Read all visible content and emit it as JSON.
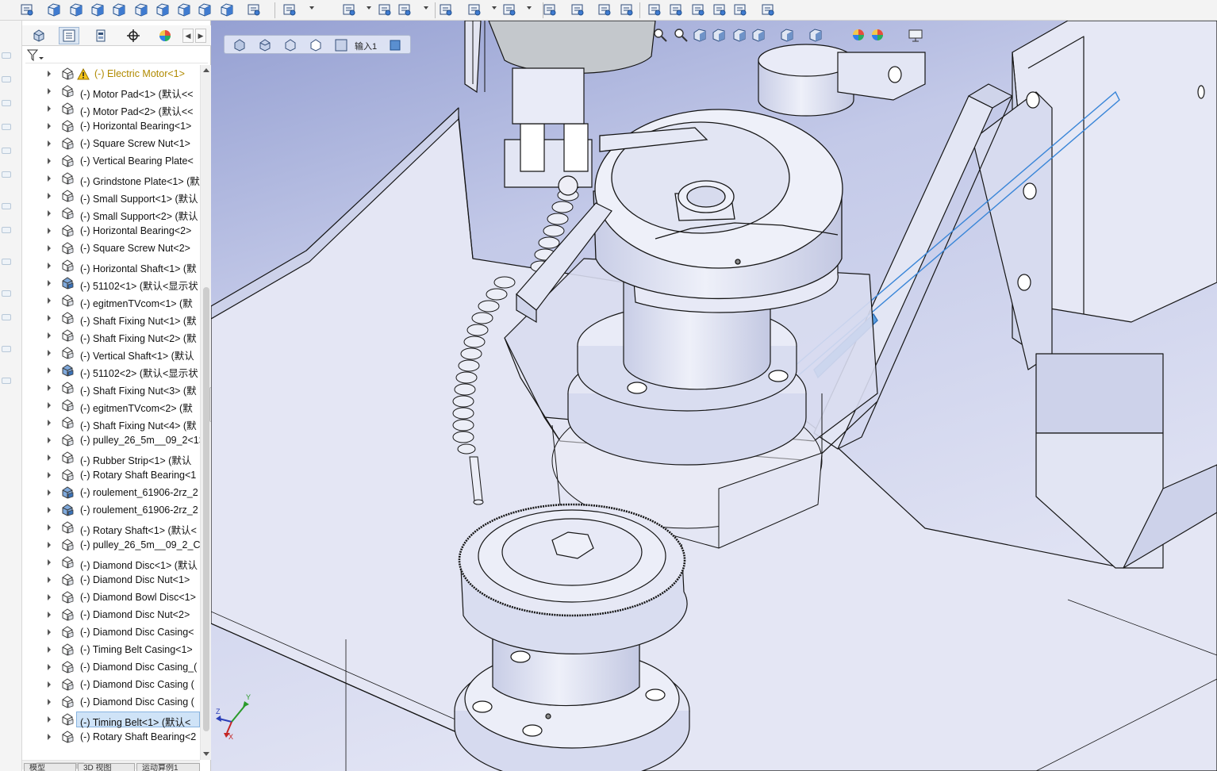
{
  "toolbar": {
    "icons": [
      "move-up-icon",
      "view-front-icon",
      "view-back-icon",
      "view-left-icon",
      "view-right-icon",
      "view-top-icon",
      "view-bottom-icon",
      "view-iso-icon",
      "view-dimetric-icon",
      "view-trimetric-icon",
      "magic-brush-icon",
      "smart-mates-icon",
      "assembly-features-icon",
      "linear-pattern-icon",
      "edit-component-icon",
      "insert-part-icon",
      "exploded-view-icon",
      "reference-geometry-icon",
      "move-component-icon",
      "interference-icon",
      "mate-icon",
      "hide-show-icon",
      "instant3d-icon",
      "bill-of-materials-icon",
      "assembly-visualization-icon",
      "large-assembly-icon",
      "speedpak-icon",
      "appearance-icon",
      "measure-icon"
    ]
  },
  "feature_manager": {
    "tabs": [
      "feature-tree-tab",
      "property-manager-tab",
      "configuration-manager-tab",
      "dimxpert-tab",
      "display-manager-tab"
    ],
    "filter_icon": "filter-icon",
    "items": [
      {
        "label": "(-) Electric Motor<1>",
        "icon": "part-icon",
        "warning": true
      },
      {
        "label": "(-) Motor Pad<1> (默认<<",
        "icon": "part-icon"
      },
      {
        "label": "(-) Motor Pad<2> (默认<<",
        "icon": "part-icon"
      },
      {
        "label": "(-) Horizontal Bearing<1>",
        "icon": "part-icon"
      },
      {
        "label": "(-) Square Screw Nut<1>",
        "icon": "part-icon"
      },
      {
        "label": "(-) Vertical Bearing Plate<",
        "icon": "part-icon"
      },
      {
        "label": "(-) Grindstone Plate<1> (默",
        "icon": "part-icon"
      },
      {
        "label": "(-) Small Support<1> (默认",
        "icon": "part-icon"
      },
      {
        "label": "(-) Small Support<2> (默认",
        "icon": "part-icon"
      },
      {
        "label": "(-) Horizontal Bearing<2>",
        "icon": "part-icon"
      },
      {
        "label": "(-) Square Screw Nut<2>",
        "icon": "part-icon"
      },
      {
        "label": "(-) Horizontal Shaft<1> (默",
        "icon": "part-icon"
      },
      {
        "label": "(-) 51102<1> (默认<显示状",
        "icon": "part-blue-icon"
      },
      {
        "label": "(-) egitmenTVcom<1> (默",
        "icon": "part-icon"
      },
      {
        "label": "(-) Shaft Fixing Nut<1> (默",
        "icon": "part-icon"
      },
      {
        "label": "(-) Shaft Fixing Nut<2> (默",
        "icon": "part-icon"
      },
      {
        "label": "(-) Vertical Shaft<1> (默认",
        "icon": "part-icon"
      },
      {
        "label": "(-) 51102<2> (默认<显示状",
        "icon": "part-blue-icon"
      },
      {
        "label": "(-) Shaft Fixing Nut<3> (默",
        "icon": "part-icon"
      },
      {
        "label": "(-) egitmenTVcom<2> (默",
        "icon": "part-icon"
      },
      {
        "label": "(-) Shaft Fixing Nut<4> (默",
        "icon": "part-icon"
      },
      {
        "label": "(-) pulley_26_5m__09_2<1>",
        "icon": "part-icon"
      },
      {
        "label": "(-) Rubber Strip<1> (默认",
        "icon": "part-icon"
      },
      {
        "label": "(-) Rotary Shaft Bearing<1",
        "icon": "part-icon"
      },
      {
        "label": "(-) roulement_61906-2rz_2",
        "icon": "part-blue-icon"
      },
      {
        "label": "(-) roulement_61906-2rz_2",
        "icon": "part-blue-icon"
      },
      {
        "label": "(-) Rotary Shaft<1> (默认<",
        "icon": "part-icon"
      },
      {
        "label": "(-) pulley_26_5m__09_2_Co",
        "icon": "part-icon"
      },
      {
        "label": "(-) Diamond Disc<1> (默认",
        "icon": "part-icon"
      },
      {
        "label": "(-) Diamond Disc Nut<1>",
        "icon": "part-icon"
      },
      {
        "label": "(-) Diamond Bowl Disc<1>",
        "icon": "part-icon"
      },
      {
        "label": "(-) Diamond Disc Nut<2>",
        "icon": "part-icon"
      },
      {
        "label": "(-) Diamond Disc Casing<",
        "icon": "part-icon"
      },
      {
        "label": "(-) Timing Belt Casing<1>",
        "icon": "part-icon"
      },
      {
        "label": "(-) Diamond Disc Casing_(",
        "icon": "part-icon"
      },
      {
        "label": "(-) Diamond Disc Casing (",
        "icon": "part-icon"
      },
      {
        "label": "(-) Diamond Disc Casing (",
        "icon": "part-icon"
      },
      {
        "label": "(-) Timing Belt<1> (默认<",
        "icon": "part-icon",
        "selected": true
      },
      {
        "label": "(-) Rotary Shaft Bearing<2",
        "icon": "part-icon"
      }
    ]
  },
  "bottom_tabs": [
    "模型",
    "3D 视图",
    "运动算例1"
  ],
  "viewport": {
    "heads_up_label": "输入1",
    "heads_up_icons": [
      "previous-view-icon",
      "section-view-icon",
      "dynamic-annotation-icon",
      "view-orientation-icon",
      "display-style-icon"
    ],
    "view_icons": [
      "zoom-to-fit-icon",
      "zoom-to-area-icon",
      "previous-view-icon",
      "section-view-icon",
      "dynamic-annotation-icon",
      "view-orientation-icon",
      "display-style-icon",
      "hide-show-items-icon",
      "edit-appearance-icon",
      "apply-scene-icon",
      "view-settings-icon"
    ],
    "triad_labels": {
      "x": "X",
      "y": "Y",
      "z": "Z"
    }
  },
  "colors": {
    "viewport_bg_top": "#9ea8d6",
    "viewport_bg_bottom": "#dcdff2",
    "part_face": "#e3e6f4",
    "part_face_dark": "#c4c9e3",
    "edge": "#1a1a1a",
    "selection_blue": "#3a86d8",
    "tree_selection": "#cfe3f7"
  }
}
